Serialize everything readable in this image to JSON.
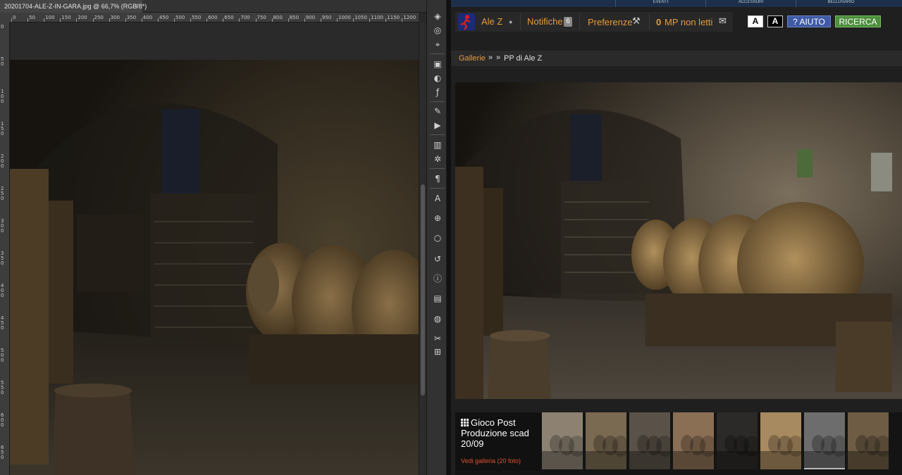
{
  "photoshop": {
    "tab_title": "20201704-ALE-Z-IN-GARA.jpg @ 66,7% (RGB/8*)",
    "tab_close": "×",
    "ruler_top_labels": [
      "0",
      "50",
      "100",
      "150",
      "200",
      "250",
      "300",
      "350",
      "400",
      "450",
      "500",
      "550",
      "600",
      "650",
      "700",
      "750",
      "800",
      "850",
      "900",
      "950",
      "1000",
      "1050",
      "1100",
      "1150",
      "1200"
    ],
    "ruler_left_labels": [
      "0",
      "50",
      "100",
      "150",
      "200",
      "250",
      "300",
      "350",
      "400",
      "450",
      "500",
      "550",
      "600",
      "650"
    ],
    "tools": [
      "layers-icon",
      "channels-icon",
      "paths-icon",
      "history-icon",
      "adjustments-icon",
      "styles-icon",
      "brush-icon",
      "actions-icon",
      "histogram-icon",
      "properties-icon",
      "paragraph-icon",
      "character-icon",
      "clone-source-icon",
      "lightbulb-icon",
      "timeline-icon",
      "info-icon",
      "gradient-icon",
      "navigator-icon",
      "tool-presets-icon",
      "libraries-icon"
    ]
  },
  "web": {
    "topnav": [
      "EVENTI",
      "ACCESSORI",
      "BELLOSARIO"
    ],
    "user": {
      "name": "Ale Z",
      "notifications_label": "Notifiche",
      "notifications_count": "6",
      "preferences_label": "Preferenze",
      "mp_count": "0",
      "mp_label": "MP non letti"
    },
    "font_buttons": [
      "A",
      "A"
    ],
    "help_label": "? AIUTO",
    "search_label": "RICERCA",
    "breadcrumb": {
      "root": "Gallerie",
      "sep1": "»",
      "sep2": "»",
      "current": "PP di Ale Z"
    },
    "gallery_card": {
      "title": "Gioco Post Produzione scad 20/09",
      "link": "Vedi galleria (20 foto)"
    },
    "thumbnails": [
      {
        "tone": "#8d8272"
      },
      {
        "tone": "#7a6a52"
      },
      {
        "tone": "#5a5248"
      },
      {
        "tone": "#8b6f55"
      },
      {
        "tone": "#2b2a28"
      },
      {
        "tone": "#a88a60"
      },
      {
        "tone": "#6d6d6d"
      },
      {
        "tone": "#6e5c44"
      }
    ]
  }
}
